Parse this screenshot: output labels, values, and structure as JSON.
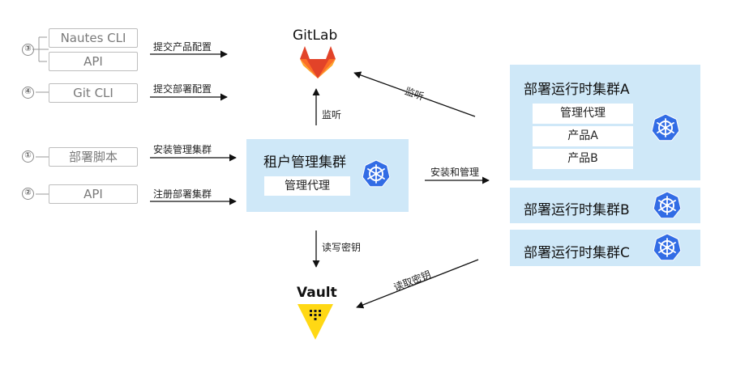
{
  "clients": {
    "marker_3": "③",
    "marker_4": "④",
    "marker_1": "①",
    "marker_2": "②",
    "nautes_cli": "Nautes CLI",
    "api_top": "API",
    "git_cli": "Git CLI",
    "deploy_script": "部署脚本",
    "api_bottom": "API"
  },
  "edges": {
    "submit_product_config": "提交产品配置",
    "submit_deploy_config": "提交部署配置",
    "install_mgmt_cluster": "安装管理集群",
    "register_deploy_cluster": "注册部署集群",
    "watch_center": "监听",
    "watch_diag": "监听",
    "install_and_manage": "安装和管理",
    "read_write_secret": "读写密钥",
    "read_secret": "读取密钥"
  },
  "gitlab": {
    "label": "GitLab"
  },
  "vault": {
    "label": "Vault"
  },
  "tenant": {
    "title": "租户管理集群",
    "agent": "管理代理"
  },
  "cluster_a": {
    "title": "部署运行时集群A",
    "agent": "管理代理",
    "product_a": "产品A",
    "product_b": "产品B"
  },
  "cluster_b": {
    "title": "部署运行时集群B"
  },
  "cluster_c": {
    "title": "部署运行时集群C"
  },
  "colors": {
    "panel": "#cfe8f8",
    "k8s_blue": "#326ce5",
    "gitlab_orange": "#e24329",
    "vault_yellow": "#ffd814"
  },
  "icons": [
    "kubernetes-icon",
    "gitlab-logo-icon",
    "vault-logo-icon"
  ]
}
